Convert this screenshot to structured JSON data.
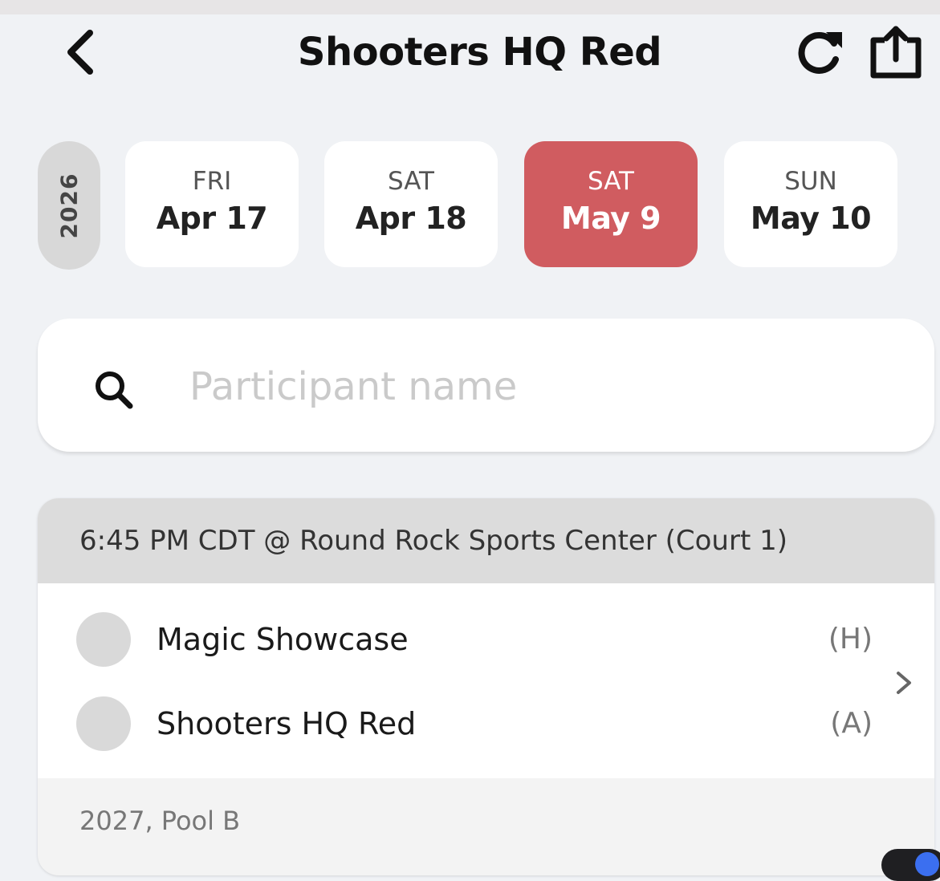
{
  "header": {
    "title": "Shooters HQ Red",
    "back_icon": "chevron-left-icon",
    "refresh_icon": "refresh-icon",
    "share_icon": "share-icon"
  },
  "date_strip": {
    "year": "2026",
    "dates": [
      {
        "dow": "FRI",
        "md": "Apr 17",
        "selected": false
      },
      {
        "dow": "SAT",
        "md": "Apr 18",
        "selected": false
      },
      {
        "dow": "SAT",
        "md": "May 9",
        "selected": true
      },
      {
        "dow": "SUN",
        "md": "May 10",
        "selected": false
      }
    ],
    "selected_color": "#d05c60"
  },
  "search": {
    "placeholder": "Participant name",
    "value": "",
    "icon": "search-icon"
  },
  "games": [
    {
      "header": "6:45 PM CDT @ Round Rock Sports Center (Court 1)",
      "teams": [
        {
          "name": "Magic Showcase",
          "side": "(H)"
        },
        {
          "name": "Shooters HQ Red",
          "side": "(A)"
        }
      ],
      "footer": "2027, Pool B"
    }
  ]
}
